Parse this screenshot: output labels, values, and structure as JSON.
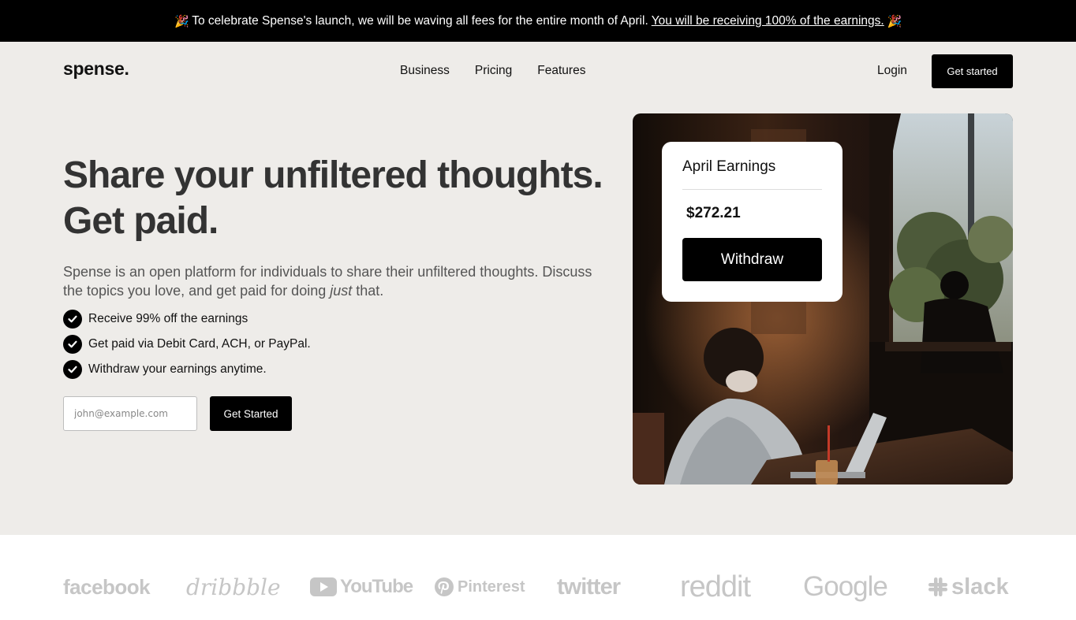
{
  "banner": {
    "emoji_left": "🎉",
    "text": "To celebrate Spense's launch, we will be waving all fees for the entire month of April.",
    "link": "You will be receiving 100% of the earnings.",
    "emoji_right": "🎉"
  },
  "header": {
    "logo": "spense.",
    "nav": [
      "Business",
      "Pricing",
      "Features"
    ],
    "login": "Login",
    "cta": "Get started"
  },
  "hero": {
    "headline_line1": "Share your unfiltered thoughts.",
    "headline_line2": "Get paid.",
    "subtext_before": "Spense is an open platform for individuals to share their unfiltered thoughts. Discuss the topics you love, and get paid for doing ",
    "subtext_emph": "just",
    "subtext_after": " that.",
    "features": [
      "Receive 99% off the earnings",
      "Get paid via Debit Card, ACH, or PayPal.",
      "Withdraw your earnings anytime."
    ],
    "email_placeholder": "john@example.com",
    "cta": "Get Started"
  },
  "earnings_card": {
    "title": "April Earnings",
    "amount": "$272.21",
    "button": "Withdraw"
  },
  "brands": {
    "facebook": "facebook",
    "dribbble": "dribbble",
    "youtube": "YouTube",
    "pinterest": "Pinterest",
    "twitter": "twitter",
    "reddit": "reddit",
    "google": "Google",
    "slack": "slack"
  },
  "colors": {
    "banner_bg": "#000000",
    "hero_bg": "#eeece9",
    "button_bg": "#000000",
    "logo_gray": "#c6c6c6"
  }
}
